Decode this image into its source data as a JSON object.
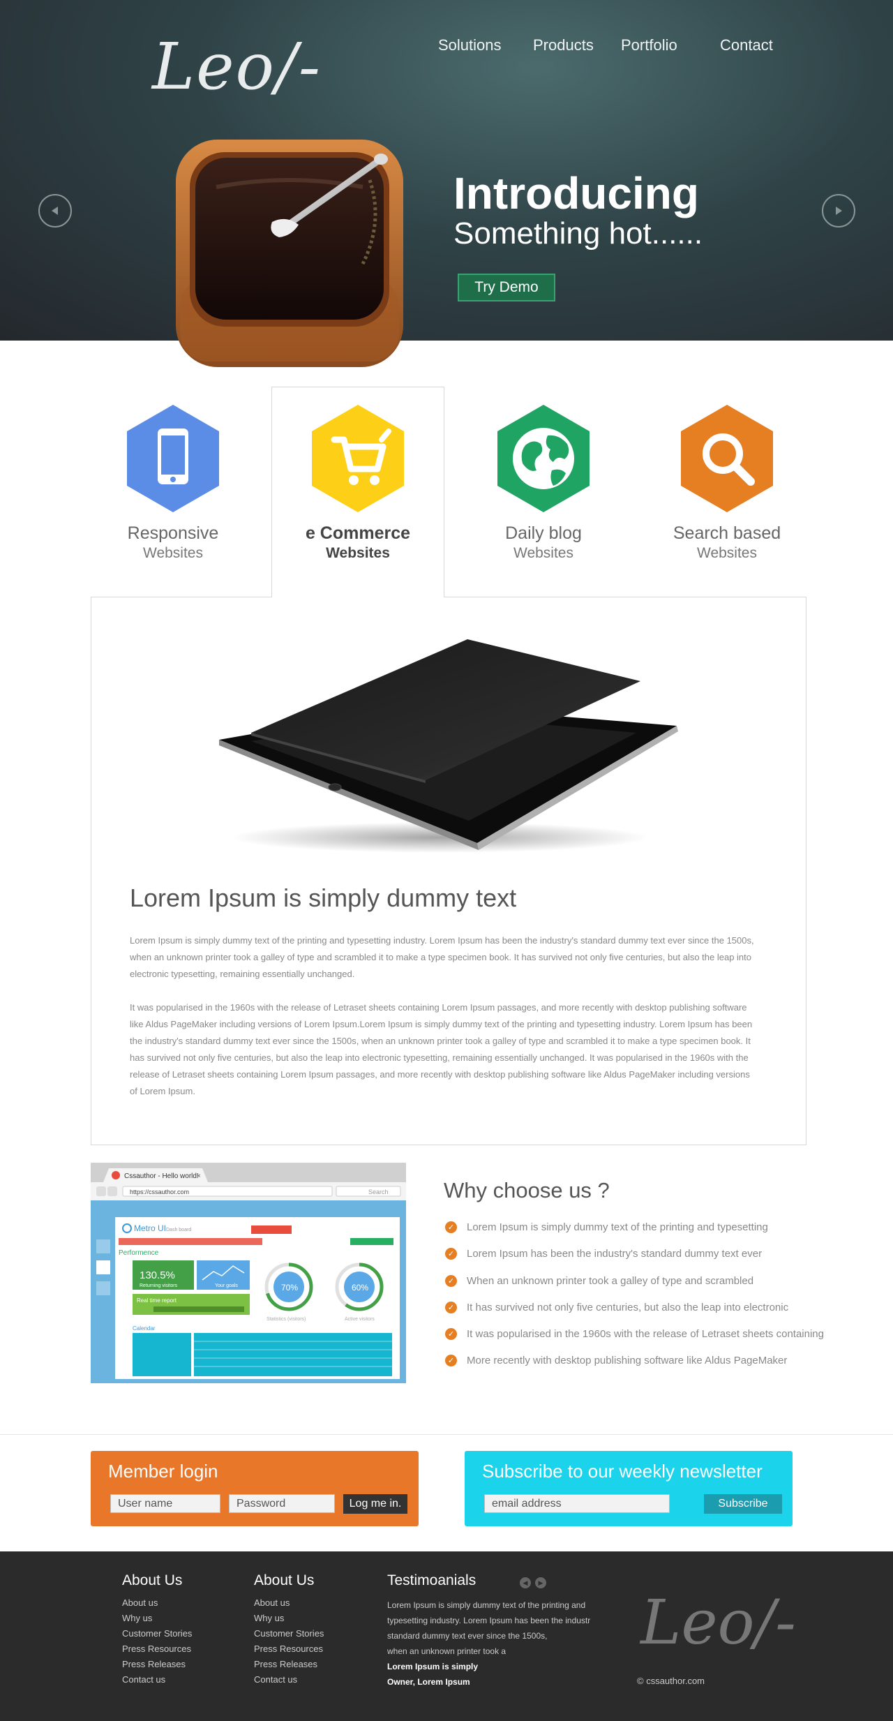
{
  "brand": {
    "logo": "Leo/-"
  },
  "nav": {
    "items": [
      "Solutions",
      "Products",
      "Portfolio",
      "Contact"
    ]
  },
  "hero": {
    "title": "Introducing",
    "subtitle": "Something hot......",
    "cta": "Try Demo"
  },
  "services": [
    {
      "line1": "Responsive",
      "line2": "Websites",
      "icon": "phone-icon",
      "color": "#5b8de6"
    },
    {
      "line1": "e Commerce",
      "line2": "Websites",
      "icon": "cart-icon",
      "color": "#fdd017"
    },
    {
      "line1": "Daily blog",
      "line2": "Websites",
      "icon": "globe-icon",
      "color": "#1fa463"
    },
    {
      "line1": "Search based",
      "line2": "Websites",
      "icon": "search-icon",
      "color": "#e67e22"
    }
  ],
  "content": {
    "title": "Lorem Ipsum is simply dummy text",
    "para1": "Lorem Ipsum is simply dummy text of the printing and typesetting industry. Lorem Ipsum has been the industry's standard dummy text ever since the 1500s, when an unknown printer took a galley of type and scrambled it to make a type specimen book. It has survived not only five centuries, but also the leap into electronic typesetting, remaining essentially unchanged.",
    "para2": "It was popularised in the 1960s with the release of Letraset sheets containing Lorem Ipsum passages, and more recently with desktop publishing software like Aldus PageMaker including versions of Lorem Ipsum.Lorem Ipsum is simply dummy text of the printing and typesetting industry. Lorem Ipsum has been the industry's standard dummy text ever since the 1500s, when an unknown printer took a galley of type and scrambled it to make a type specimen book. It has survived not only five centuries, but also the leap into electronic typesetting, remaining essentially unchanged. It was popularised in the 1960s with the release of Letraset sheets containing Lorem Ipsum passages, and more recently with desktop publishing software like Aldus PageMaker including versions of Lorem Ipsum."
  },
  "browser_mock": {
    "tab": "Cssauthor - Hello world!",
    "url": "https://cssauthor.com",
    "search": "Search",
    "app_title": "Metro UI",
    "app_subtitle": "Dash board",
    "section": "Performence",
    "stat": "130.5%",
    "stat_label": "Returning visitors",
    "goals": "Your goals",
    "report": "Real time report",
    "calendar": "Calendar",
    "pie1": "70%",
    "pie1_label": "Statistics (visitors)",
    "pie2": "60%",
    "pie2_label": "Active visitors"
  },
  "why": {
    "title": "Why choose us ?",
    "items": [
      "Lorem Ipsum is simply dummy text of the printing and typesetting",
      "Lorem Ipsum has been the industry's standard dummy text ever",
      "When an unknown printer took a galley of type and scrambled",
      "It has survived not only five centuries, but also the leap into electronic",
      "It was popularised in the 1960s with the release of Letraset sheets containing",
      "More recently with desktop publishing software like Aldus PageMaker"
    ]
  },
  "login": {
    "title": "Member login",
    "user_placeholder": "User name",
    "pass_placeholder": "Password",
    "button": "Log me in."
  },
  "newsletter": {
    "title": "Subscribe to our weekly newsletter",
    "email_placeholder": "email address",
    "button": "Subscribe"
  },
  "footer": {
    "col1": {
      "title": "About Us",
      "links": [
        "About us",
        "Why us",
        "Customer Stories",
        "Press Resources",
        "Press Releases",
        "Contact us"
      ]
    },
    "col2": {
      "title": "About Us",
      "links": [
        "About us",
        "Why us",
        "Customer Stories",
        "Press Resources",
        "Press Releases",
        "Contact us"
      ]
    },
    "testimonials": {
      "title": "Testimoanials",
      "lines": [
        "Lorem Ipsum is simply dummy text of the printing and",
        "typesetting industry. Lorem Ipsum has been the industr",
        "standard dummy text ever since the 1500s,",
        "when an unknown printer took a"
      ],
      "author": "Lorem Ipsum is simply",
      "role": "Owner, Lorem Ipsum"
    },
    "logo": "Leo/-",
    "copyright": "© cssauthor.com"
  }
}
